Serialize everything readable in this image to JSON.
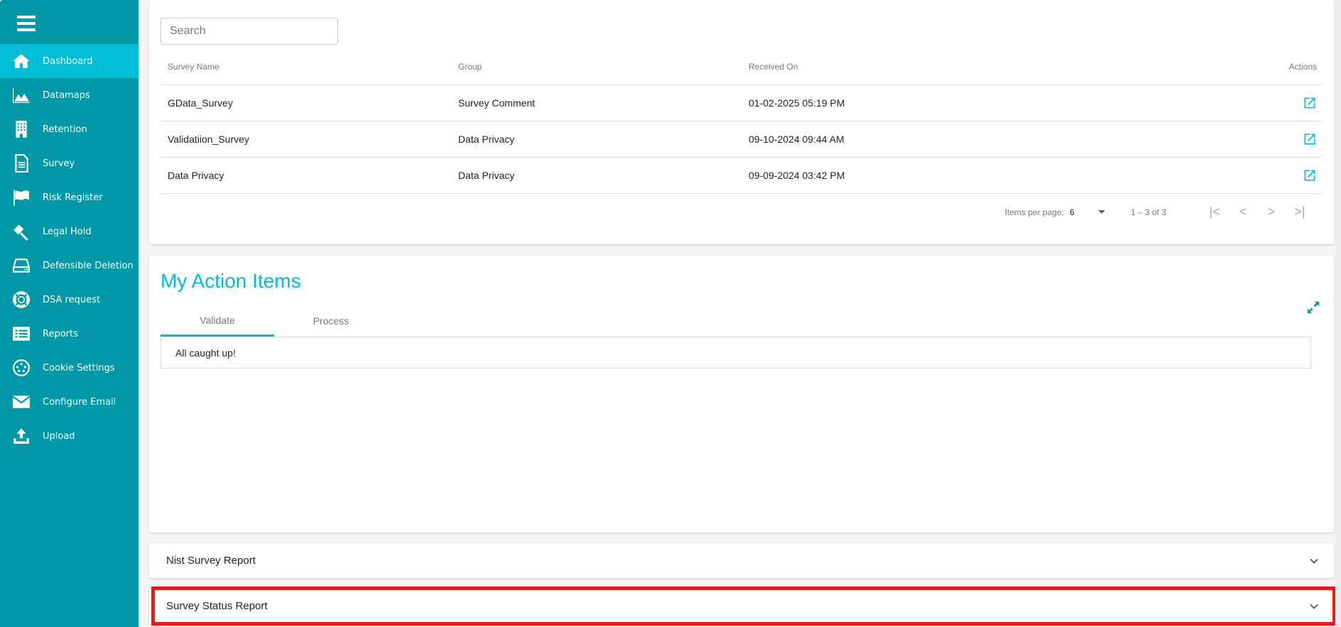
{
  "sidebar": {
    "menu_icon": "hamburger-menu-icon",
    "items": [
      {
        "label": "Dashboard",
        "icon": "home-icon",
        "active": true
      },
      {
        "label": "Datamaps",
        "icon": "area-chart-icon"
      },
      {
        "label": "Retention",
        "icon": "building-icon"
      },
      {
        "label": "Survey",
        "icon": "document-icon"
      },
      {
        "label": "Risk Register",
        "icon": "flag-icon"
      },
      {
        "label": "Legal Hold",
        "icon": "gavel-icon"
      },
      {
        "label": "Defensible Deletion",
        "icon": "hard-drive-icon"
      },
      {
        "label": "DSA request",
        "icon": "life-ring-icon"
      },
      {
        "label": "Reports",
        "icon": "list-icon"
      },
      {
        "label": "Cookie Settings",
        "icon": "cookie-icon"
      },
      {
        "label": "Configure Email",
        "icon": "envelope-icon"
      },
      {
        "label": "Upload",
        "icon": "upload-icon"
      }
    ]
  },
  "surveys": {
    "search_placeholder": "Search",
    "columns": [
      "Survey Name",
      "Group",
      "Received On",
      "Actions"
    ],
    "rows": [
      {
        "name": "GData_Survey",
        "group": "Survey Comment",
        "received": "01-02-2025 05:19 PM",
        "action_icon": "open-in-new-icon"
      },
      {
        "name": "Validatiion_Survey",
        "group": "Data Privacy",
        "received": "09-10-2024 09:44 AM",
        "action_icon": "open-in-new-icon"
      },
      {
        "name": "Data Privacy",
        "group": "Data Privacy",
        "received": "09-09-2024 03:42 PM",
        "action_icon": "open-in-new-icon"
      }
    ],
    "pager": {
      "items_per_page_label": "Items per page:",
      "items_per_page": "6",
      "range": "1 – 3 of 3",
      "first": "|<",
      "prev": "<",
      "next": ">",
      "last": ">|"
    }
  },
  "action_items": {
    "title": "My Action Items",
    "tabs": [
      {
        "label": "Validate",
        "active": true
      },
      {
        "label": "Process",
        "active": false
      }
    ],
    "empty_message": "All caught up!"
  },
  "reports": [
    {
      "label": "Nist Survey Report"
    },
    {
      "label": "Survey Status Report",
      "highlighted": true
    }
  ],
  "colors": {
    "sidebar": "#0097a7",
    "sidebar_active": "#00bcd4",
    "accent": "#00bcd4",
    "highlight": "#e31b1b"
  }
}
